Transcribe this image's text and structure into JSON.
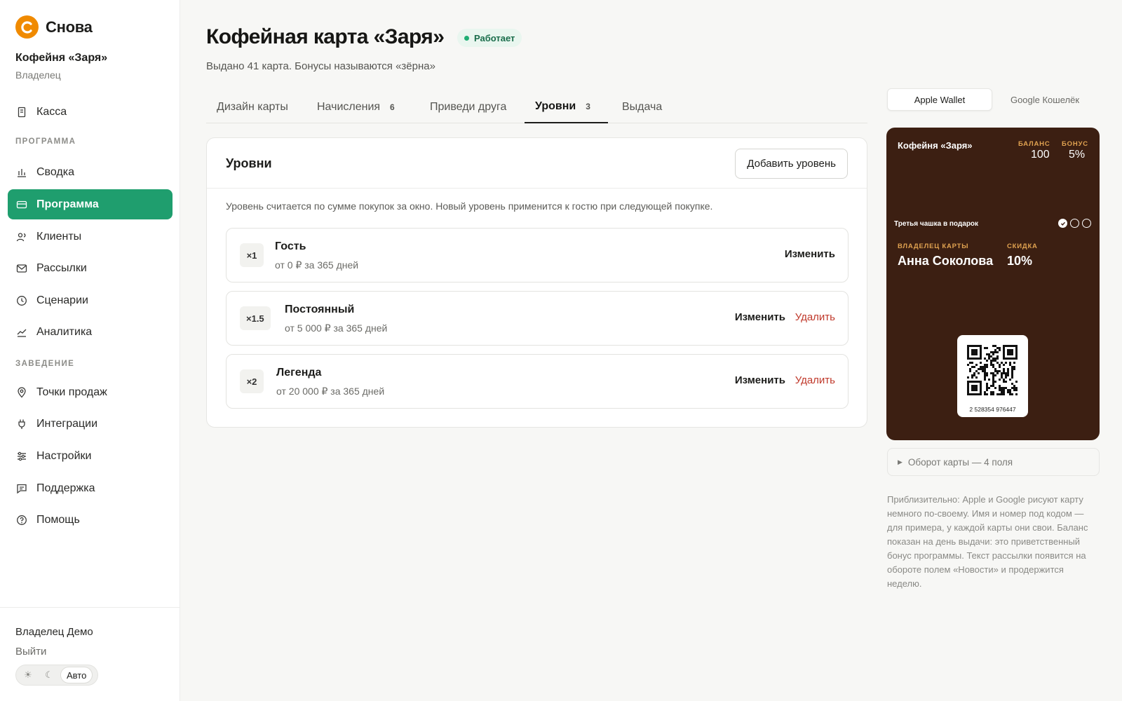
{
  "brand": {
    "name": "Снова"
  },
  "venue": {
    "name": "Кофейня «Заря»",
    "role": "Владелец"
  },
  "nav": {
    "kassa": "Касса",
    "section_program": "ПРОГРАММА",
    "summary": "Сводка",
    "program": "Программа",
    "clients": "Клиенты",
    "mailings": "Рассылки",
    "scenarios": "Сценарии",
    "analytics": "Аналитика",
    "section_venue": "ЗАВЕДЕНИЕ",
    "points": "Точки продаж",
    "integrations": "Интеграции",
    "settings": "Настройки",
    "support": "Поддержка",
    "help": "Помощь"
  },
  "user": {
    "name": "Владелец Демо",
    "logout": "Выйти"
  },
  "theme": {
    "light": "☀",
    "dark": "☾",
    "auto": "Авто"
  },
  "page": {
    "title": "Кофейная карта «Заря»",
    "status": "Работает",
    "subtitle": "Выдано 41 карта. Бонусы называются «зёрна»"
  },
  "tabs": [
    {
      "label": "Дизайн карты",
      "count": ""
    },
    {
      "label": "Начисления",
      "count": "6"
    },
    {
      "label": "Приведи друга",
      "count": ""
    },
    {
      "label": "Уровни",
      "count": "3"
    },
    {
      "label": "Выдача",
      "count": ""
    }
  ],
  "panel": {
    "title": "Уровни",
    "add_button": "Добавить уровень",
    "description": "Уровень считается по сумме покупок за окно. Новый уровень применится к гостю при следующей покупке.",
    "edit_label": "Изменить",
    "delete_label": "Удалить",
    "levels": [
      {
        "multiplier": "×1",
        "name": "Гость",
        "range": "от 0 ₽ за 365 дней"
      },
      {
        "multiplier": "×1.5",
        "name": "Постоянный",
        "range": "от 5 000 ₽ за 365 дней"
      },
      {
        "multiplier": "×2",
        "name": "Легенда",
        "range": "от 20 000 ₽ за 365 дней"
      }
    ]
  },
  "wallet_tabs": {
    "apple": "Apple Wallet",
    "google": "Google Кошелёк"
  },
  "card": {
    "venue": "Кофейня «Заря»",
    "balance_label": "БАЛАНС",
    "balance_value": "100",
    "bonus_label": "БОНУС",
    "bonus_value": "5%",
    "promo": "Третья чашка в подарок",
    "stamps_filled": 1,
    "stamps_total": 3,
    "holder_label": "ВЛАДЕЛЕЦ КАРТЫ",
    "holder_name": "Анна Соколова",
    "discount_label": "СКИДКА",
    "discount_value": "10%",
    "number": "2 528354 976447",
    "background": "#3c1f12",
    "accent": "#e0a250"
  },
  "card_back": {
    "arrow": "▶",
    "label": "Оборот карты — 4 поля"
  },
  "note": "Приблизительно: Apple и Google рисуют карту немного по-своему. Имя и номер под кодом — для примера, у каждой карты они свои. Баланс показан на день выдачи: это приветственный бонус программы. Текст рассылки появится на обороте полем «Новости» и продержится неделю.",
  "colors": {
    "accent": "#1f9e6e",
    "brand": "#f08a00",
    "danger": "#c0392b"
  }
}
